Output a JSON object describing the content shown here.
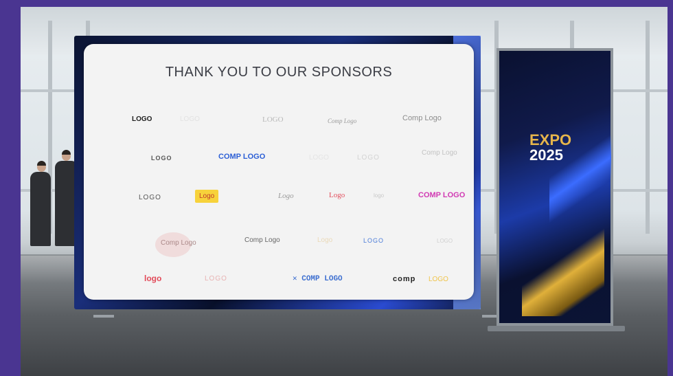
{
  "backdrop": {
    "title": "THANK YOU TO OUR SPONSORS"
  },
  "sponsors": {
    "row1": [
      "LOGO",
      "LOGO",
      "LOGO",
      "Comp Logo",
      "Comp Logo"
    ],
    "row2": [
      "LOGO",
      "COMP LOGO",
      "LOGO",
      "LOGO",
      "Comp Logo"
    ],
    "row3": [
      "LOGO",
      "Logo",
      "Logo",
      "Logo",
      "logo",
      "COMP LOGO"
    ],
    "row4": [
      "Comp Logo",
      "Comp Logo",
      "Logo",
      "LOGO",
      "LOGO"
    ],
    "row5": [
      "logo",
      "LOGO",
      "COMP LOGO",
      "comp",
      "LOGO"
    ]
  },
  "banner": {
    "line1": "EXPO",
    "line2": "2025"
  },
  "colors": {
    "frame": "#4a3591",
    "gold": "#e6b54b",
    "pink": "#d13ab3",
    "blue": "#2c5fd6",
    "red": "#e24b5a"
  }
}
